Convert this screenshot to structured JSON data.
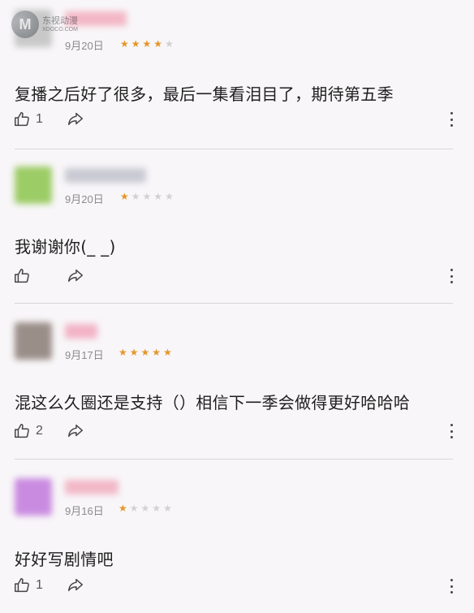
{
  "watermark": {
    "brand_cn": "东视动漫",
    "brand_en": "XDOCO.COM",
    "badge": "M"
  },
  "colors": {
    "star_on": "#e5962a",
    "star_off": "#d2d0d2",
    "background": "#f8f6f8"
  },
  "comments": [
    {
      "avatar_color": "#c8c8c8",
      "name_color": "#f3b7c6",
      "date": "9月20日",
      "rating": 4,
      "text": "复播之后好了很多，最后一集看泪目了，期待第五季",
      "likes": "1",
      "like_icon": "thumbs-up-icon",
      "share_icon": "share-arrow-icon",
      "more_icon": "more-vertical-icon"
    },
    {
      "avatar_color": "#9ccc65",
      "name_color": "#c9c9d3",
      "date": "9月20日",
      "rating": 1,
      "text": "我谢谢你(_ _)",
      "likes": "",
      "like_icon": "thumbs-up-icon",
      "share_icon": "share-arrow-icon",
      "more_icon": "more-vertical-icon"
    },
    {
      "avatar_color": "#9a8e88",
      "name_color": "#f2b3c6",
      "date": "9月17日",
      "rating": 5,
      "text": "混这么久圈还是支持（）相信下一季会做得更好哈哈哈",
      "likes": "2",
      "like_icon": "thumbs-up-icon",
      "share_icon": "share-arrow-icon",
      "more_icon": "more-vertical-icon"
    },
    {
      "avatar_color": "#c98be0",
      "name_color": "#f2b8c8",
      "date": "9月16日",
      "rating": 1,
      "text": "好好写剧情吧",
      "likes": "1",
      "like_icon": "thumbs-up-icon",
      "share_icon": "share-arrow-icon",
      "more_icon": "more-vertical-icon"
    }
  ]
}
